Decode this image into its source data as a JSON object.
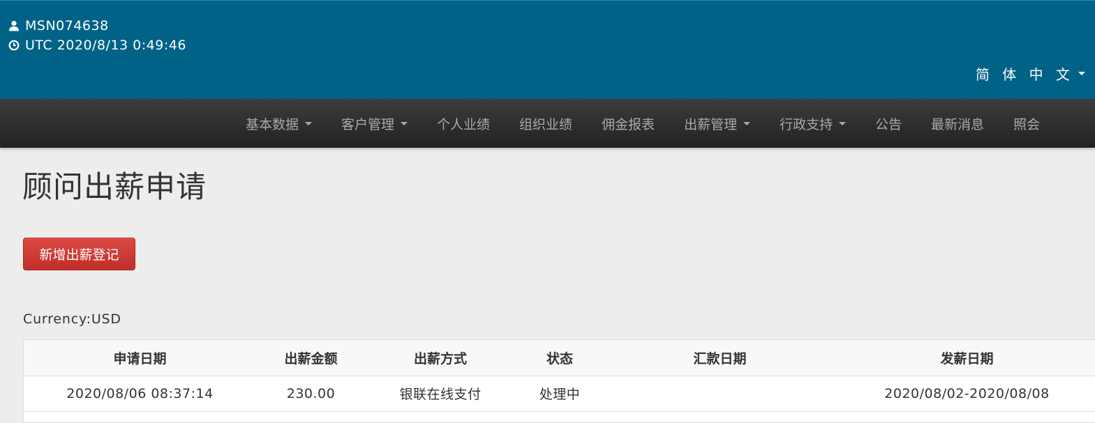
{
  "header": {
    "username": "MSN074638",
    "datetime": "UTC 2020/8/13 0:49:46",
    "language": "简 体 中 文",
    "user_icon": "user-icon",
    "clock_icon": "clock-icon",
    "colors": {
      "header_bg": "#006287",
      "navbar_bg": "#2b2b2b",
      "accent_button": "#c9302c"
    }
  },
  "nav": {
    "items": [
      {
        "label": "基本数据",
        "dropdown": true
      },
      {
        "label": "客户管理",
        "dropdown": true
      },
      {
        "label": "个人业绩",
        "dropdown": false
      },
      {
        "label": "组织业绩",
        "dropdown": false
      },
      {
        "label": "佣金报表",
        "dropdown": false
      },
      {
        "label": "出薪管理",
        "dropdown": true
      },
      {
        "label": "行政支持",
        "dropdown": true
      },
      {
        "label": "公告",
        "dropdown": false
      },
      {
        "label": "最新消息",
        "dropdown": false
      },
      {
        "label": "照会",
        "dropdown": false
      }
    ]
  },
  "main": {
    "title": "顾问出薪申请",
    "add_button": "新增出薪登记",
    "currency": "Currency:USD",
    "table": {
      "columns": [
        "申请日期",
        "出薪金额",
        "出薪方式",
        "状态",
        "汇款日期",
        "发薪日期"
      ],
      "rows": [
        [
          "2020/08/06 08:37:14",
          "230.00",
          "银联在线支付",
          "处理中",
          "",
          "2020/08/02-2020/08/08"
        ]
      ]
    }
  }
}
